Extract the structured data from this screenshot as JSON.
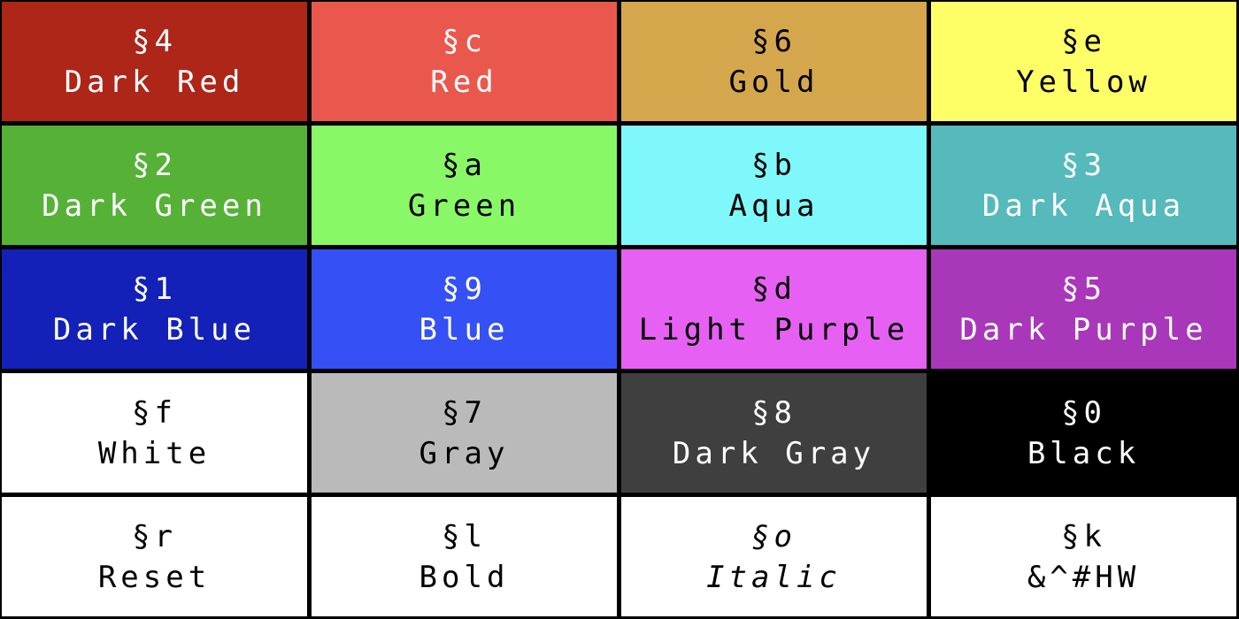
{
  "cells": [
    {
      "code": "§4",
      "name": "Dark Red",
      "bg": "#ad2618",
      "fg": "#ffffff"
    },
    {
      "code": "§c",
      "name": "Red",
      "bg": "#ea574d",
      "fg": "#ffffff"
    },
    {
      "code": "§6",
      "name": "Gold",
      "bg": "#d5a74c",
      "fg": "#000000"
    },
    {
      "code": "§e",
      "name": "Yellow",
      "bg": "#fefe66",
      "fg": "#000000"
    },
    {
      "code": "§2",
      "name": "Dark Green",
      "bg": "#55b237",
      "fg": "#ffffff"
    },
    {
      "code": "§a",
      "name": "Green",
      "bg": "#88f867",
      "fg": "#000000"
    },
    {
      "code": "§b",
      "name": "Aqua",
      "bg": "#7ef8fb",
      "fg": "#000000"
    },
    {
      "code": "§3",
      "name": "Dark Aqua",
      "bg": "#56b9bc",
      "fg": "#ffffff"
    },
    {
      "code": "§1",
      "name": "Dark Blue",
      "bg": "#1321b8",
      "fg": "#ffffff"
    },
    {
      "code": "§9",
      "name": "Blue",
      "bg": "#3550f5",
      "fg": "#ffffff"
    },
    {
      "code": "§d",
      "name": "Light Purple",
      "bg": "#e661f3",
      "fg": "#000000"
    },
    {
      "code": "§5",
      "name": "Dark Purple",
      "bg": "#a937b9",
      "fg": "#ffffff"
    },
    {
      "code": "§f",
      "name": "White",
      "bg": "#ffffff",
      "fg": "#000000"
    },
    {
      "code": "§7",
      "name": "Gray",
      "bg": "#bababa",
      "fg": "#000000"
    },
    {
      "code": "§8",
      "name": "Dark Gray",
      "bg": "#3f3f3f",
      "fg": "#ffffff"
    },
    {
      "code": "§0",
      "name": "Black",
      "bg": "#000000",
      "fg": "#ffffff"
    },
    {
      "code": "§r",
      "name": "Reset",
      "bg": "#ffffff",
      "fg": "#000000"
    },
    {
      "code": "§l",
      "name": "Bold",
      "bg": "#ffffff",
      "fg": "#000000"
    },
    {
      "code": "§o",
      "name": "Italic",
      "bg": "#ffffff",
      "fg": "#000000",
      "style": "italic"
    },
    {
      "code": "§k",
      "name": "&^#HW",
      "bg": "#ffffff",
      "fg": "#000000"
    }
  ]
}
